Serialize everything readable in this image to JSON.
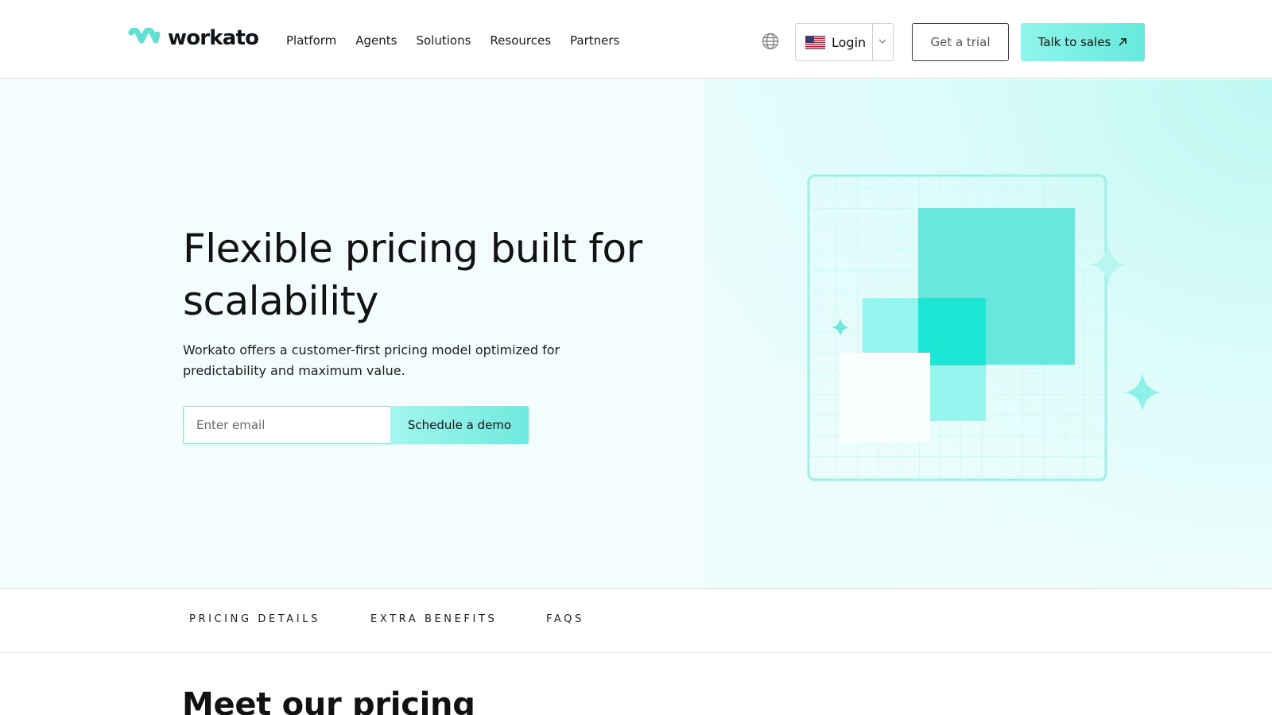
{
  "header": {
    "logo_text": "workato",
    "nav": [
      "Platform",
      "Agents",
      "Solutions",
      "Resources",
      "Partners"
    ],
    "login_label": "Login",
    "trial_label": "Get a trial",
    "sales_label": "Talk to sales",
    "icons": {
      "globe": "globe-icon",
      "flag": "us-flag-icon",
      "dropdown": "chevron-down-icon",
      "external": "arrow-up-right-icon"
    }
  },
  "hero": {
    "title": "Flexible pricing built for scalability",
    "subtitle": "Workato offers a customer-first pricing model optimized for predictability and maximum value.",
    "email_placeholder": "Enter email",
    "email_value": "",
    "demo_label": "Schedule a demo"
  },
  "subnav": {
    "items": [
      "PRICING DETAILS",
      "EXTRA BENEFITS",
      "FAQS"
    ]
  },
  "section": {
    "title": "Meet our pricing"
  },
  "colors": {
    "brand_teal": "#67e8dc",
    "brand_teal_light": "#a3f6ee",
    "hero_bg": "#f4fdfd",
    "text": "#121212"
  }
}
